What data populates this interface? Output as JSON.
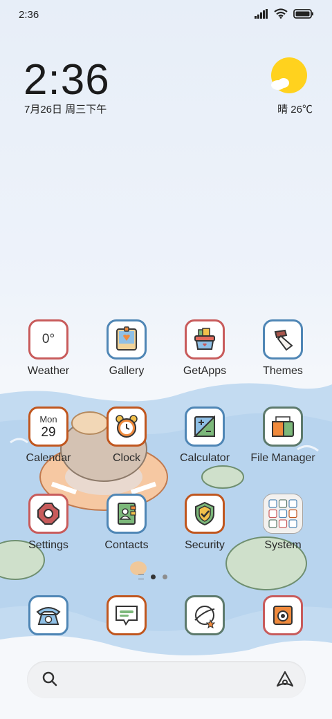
{
  "status_bar": {
    "time": "2:36"
  },
  "clock_widget": {
    "time": "2:36",
    "date": "7月26日 周三下午"
  },
  "weather_widget": {
    "text": "晴 26℃"
  },
  "apps": {
    "weather": {
      "label": "Weather",
      "tile_text": "0°"
    },
    "gallery": {
      "label": "Gallery"
    },
    "getapps": {
      "label": "GetApps"
    },
    "themes": {
      "label": "Themes"
    },
    "calendar": {
      "label": "Calendar",
      "month": "Mon",
      "day": "29"
    },
    "clock": {
      "label": "Clock"
    },
    "calculator": {
      "label": "Calculator"
    },
    "file_manager": {
      "label": "File Manager"
    },
    "settings": {
      "label": "Settings"
    },
    "contacts": {
      "label": "Contacts"
    },
    "security": {
      "label": "Security"
    },
    "system": {
      "label": "System"
    }
  },
  "dock": [
    "phone",
    "messages",
    "browser",
    "camera"
  ],
  "page_indicator": {
    "pages": 3,
    "current": 2
  },
  "colors": {
    "red_border": "#c85b5b",
    "blue_border": "#4f86b5",
    "orange_border": "#c0561e",
    "green_border": "#5d7a6c",
    "water": "#bcd6ef"
  }
}
